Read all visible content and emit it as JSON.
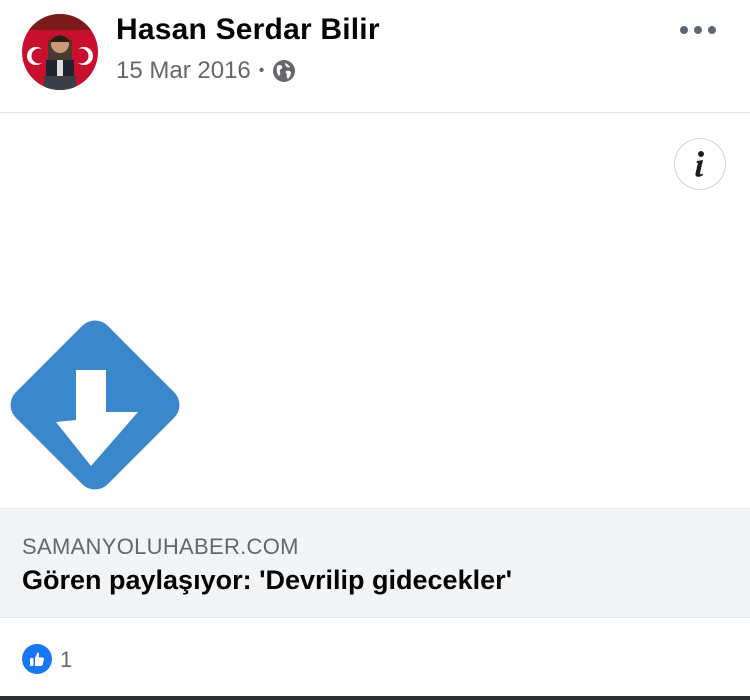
{
  "post": {
    "author": "Hasan Serdar Bilir",
    "date": "15 Mar 2016",
    "separator": "•",
    "privacy_icon": "globe-icon",
    "more_icon": "more-options-icon"
  },
  "link": {
    "info_icon": "info-icon",
    "domain": "SAMANYOLUHABER.COM",
    "title": "Gören paylaşıyor: 'Devrilip gidecekler'"
  },
  "reactions": {
    "icon": "like-icon",
    "count": "1"
  },
  "colors": {
    "accent": "#1877f2",
    "logo_blue": "#3b87cc",
    "secondary_text": "#65676b",
    "preview_bg": "#f2f4f6"
  }
}
